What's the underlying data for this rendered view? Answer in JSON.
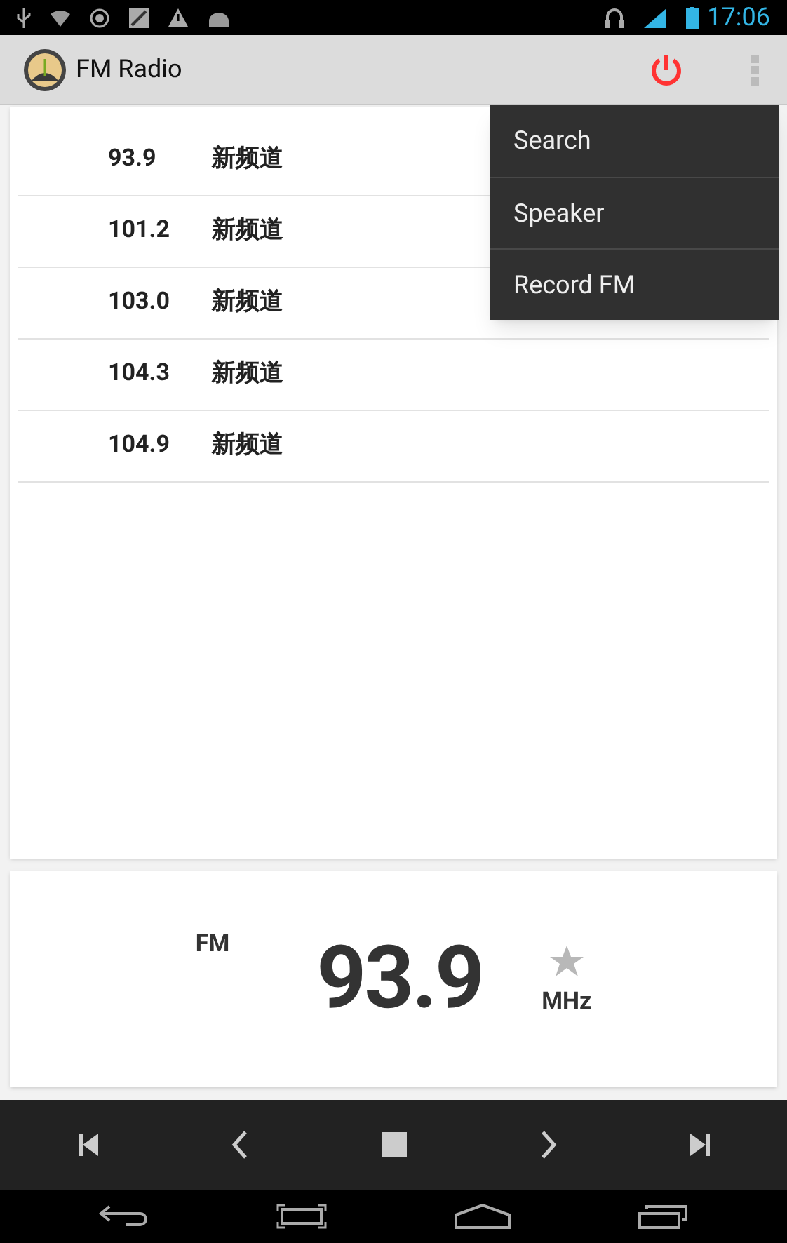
{
  "status_bar": {
    "time": "17:06"
  },
  "action_bar": {
    "title": "FM Radio"
  },
  "stations": [
    {
      "frequency": "93.9",
      "name": "新频道"
    },
    {
      "frequency": "101.2",
      "name": "新频道"
    },
    {
      "frequency": "103.0",
      "name": "新频道"
    },
    {
      "frequency": "104.3",
      "name": "新频道"
    },
    {
      "frequency": "104.9",
      "name": "新频道"
    }
  ],
  "overflow_menu": [
    "Search",
    "Speaker",
    "Record FM"
  ],
  "tuner": {
    "band": "FM",
    "frequency": "93.9",
    "unit": "MHz",
    "favorite": false
  }
}
